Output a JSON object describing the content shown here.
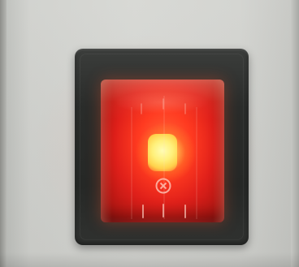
{
  "image": {
    "subject": "rocker-switch",
    "state": "on",
    "colors": {
      "wall": "#d6d7d3",
      "bezel": "#2a2c2a",
      "rocker_red": "#e0201a",
      "glow": "#fff07a"
    },
    "icons": {
      "power_symbol": "power-icon"
    }
  }
}
